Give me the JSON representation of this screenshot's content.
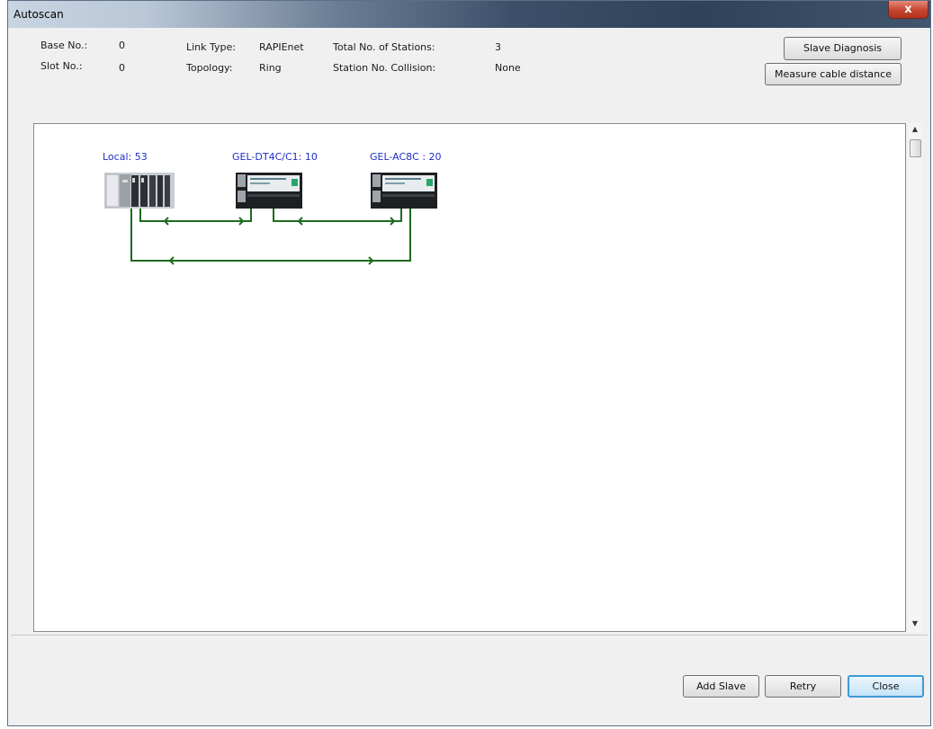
{
  "window": {
    "title": "Autoscan",
    "close_glyph": "x"
  },
  "info": {
    "base_no_label": "Base No.:",
    "base_no_value": "0",
    "slot_no_label": "Slot No.:",
    "slot_no_value": "0",
    "link_type_label": "Link Type:",
    "link_type_value": "RAPIEnet",
    "topology_label": "Topology:",
    "topology_value": "Ring",
    "total_stations_label": "Total No. of Stations:",
    "total_stations_value": "3",
    "collision_label": "Station No. Collision:",
    "collision_value": "None"
  },
  "buttons": {
    "slave_diagnosis": "Slave Diagnosis",
    "measure_cable": "Measure cable distance",
    "add_slave": "Add Slave",
    "retry": "Retry",
    "close": "Close"
  },
  "network": {
    "nodes": [
      {
        "label": "Local: 53",
        "icon": "plc-rack-icon"
      },
      {
        "label": "GEL-DT4C/C1: 10",
        "icon": "io-module-icon"
      },
      {
        "label": "GEL-AC8C : 20",
        "icon": "io-module-icon"
      }
    ],
    "link_color": "#1e6b1e",
    "label_color": "#1f2fc8"
  }
}
